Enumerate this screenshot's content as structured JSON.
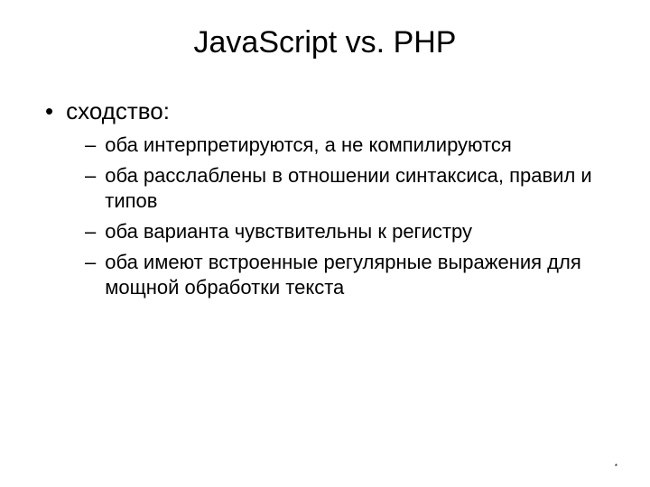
{
  "slide": {
    "title": "JavaScript vs. PHP",
    "bullet_marker_l1": "•",
    "bullet_marker_l2": "–",
    "bullets": [
      {
        "text": "сходство:",
        "sub": [
          "оба интерпретируются, а не компилируются",
          "оба расслаблены в отношении синтаксиса, правил и типов",
          "оба варианта чувствительны к регистру",
          "оба имеют встроенные регулярные выражения для мощной обработки текста"
        ]
      }
    ],
    "footer_mark": "*"
  }
}
